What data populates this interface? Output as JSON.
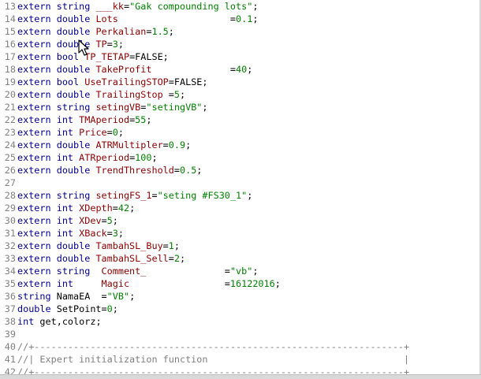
{
  "editor": {
    "lines": [
      {
        "num": "13",
        "tokens": [
          {
            "t": "extern string ",
            "c": "kw"
          },
          {
            "t": "___kk",
            "c": "id"
          },
          {
            "t": "=",
            "c": "op"
          },
          {
            "t": "\"Gak compounding lots\"",
            "c": "str"
          },
          {
            "t": ";",
            "c": "op"
          }
        ]
      },
      {
        "num": "14",
        "tokens": [
          {
            "t": "extern double ",
            "c": "kw"
          },
          {
            "t": "Lots",
            "c": "id"
          },
          {
            "t": "                    =",
            "c": "op"
          },
          {
            "t": "0.1",
            "c": "num"
          },
          {
            "t": ";",
            "c": "op"
          }
        ]
      },
      {
        "num": "15",
        "tokens": [
          {
            "t": "extern double ",
            "c": "kw"
          },
          {
            "t": "Perkalian",
            "c": "id"
          },
          {
            "t": "=",
            "c": "op"
          },
          {
            "t": "1.5",
            "c": "num"
          },
          {
            "t": ";",
            "c": "op"
          }
        ]
      },
      {
        "num": "16",
        "tokens": [
          {
            "t": "extern double ",
            "c": "kw"
          },
          {
            "t": "TP",
            "c": "id"
          },
          {
            "t": "=",
            "c": "op"
          },
          {
            "t": "3",
            "c": "num"
          },
          {
            "t": ";",
            "c": "op"
          }
        ]
      },
      {
        "num": "17",
        "tokens": [
          {
            "t": "extern bool ",
            "c": "kw"
          },
          {
            "t": "TP_TETAP",
            "c": "id"
          },
          {
            "t": "=FALSE;",
            "c": "op"
          }
        ]
      },
      {
        "num": "18",
        "tokens": [
          {
            "t": "extern double ",
            "c": "kw"
          },
          {
            "t": "TakeProfit",
            "c": "id"
          },
          {
            "t": "              =",
            "c": "op"
          },
          {
            "t": "40",
            "c": "num"
          },
          {
            "t": ";",
            "c": "op"
          }
        ]
      },
      {
        "num": "19",
        "tokens": [
          {
            "t": "extern bool ",
            "c": "kw"
          },
          {
            "t": "UseTrailingSTOP",
            "c": "id"
          },
          {
            "t": "=FALSE;",
            "c": "op"
          }
        ]
      },
      {
        "num": "20",
        "tokens": [
          {
            "t": "extern double ",
            "c": "kw"
          },
          {
            "t": "TrailingStop",
            "c": "id"
          },
          {
            "t": " =",
            "c": "op"
          },
          {
            "t": "5",
            "c": "num"
          },
          {
            "t": ";",
            "c": "op"
          }
        ]
      },
      {
        "num": "21",
        "tokens": [
          {
            "t": "extern string ",
            "c": "kw"
          },
          {
            "t": "setingVB",
            "c": "id"
          },
          {
            "t": "=",
            "c": "op"
          },
          {
            "t": "\"setingVB\"",
            "c": "str"
          },
          {
            "t": ";",
            "c": "op"
          }
        ]
      },
      {
        "num": "22",
        "tokens": [
          {
            "t": "extern int ",
            "c": "kw"
          },
          {
            "t": "TMAperiod",
            "c": "id"
          },
          {
            "t": "=",
            "c": "op"
          },
          {
            "t": "55",
            "c": "num"
          },
          {
            "t": ";",
            "c": "op"
          }
        ]
      },
      {
        "num": "23",
        "tokens": [
          {
            "t": "extern int ",
            "c": "kw"
          },
          {
            "t": "Price",
            "c": "id"
          },
          {
            "t": "=",
            "c": "op"
          },
          {
            "t": "0",
            "c": "num"
          },
          {
            "t": ";",
            "c": "op"
          }
        ]
      },
      {
        "num": "24",
        "tokens": [
          {
            "t": "extern double ",
            "c": "kw"
          },
          {
            "t": "ATRMultipler",
            "c": "id"
          },
          {
            "t": "=",
            "c": "op"
          },
          {
            "t": "0.9",
            "c": "num"
          },
          {
            "t": ";",
            "c": "op"
          }
        ]
      },
      {
        "num": "25",
        "tokens": [
          {
            "t": "extern int ",
            "c": "kw"
          },
          {
            "t": "ATRperiod",
            "c": "id"
          },
          {
            "t": "=",
            "c": "op"
          },
          {
            "t": "100",
            "c": "num"
          },
          {
            "t": ";",
            "c": "op"
          }
        ]
      },
      {
        "num": "26",
        "tokens": [
          {
            "t": "extern double ",
            "c": "kw"
          },
          {
            "t": "TrendThreshold",
            "c": "id"
          },
          {
            "t": "=",
            "c": "op"
          },
          {
            "t": "0.5",
            "c": "num"
          },
          {
            "t": ";",
            "c": "op"
          }
        ]
      },
      {
        "num": "27",
        "tokens": []
      },
      {
        "num": "28",
        "tokens": [
          {
            "t": "extern string ",
            "c": "kw"
          },
          {
            "t": "setingFS_1",
            "c": "id"
          },
          {
            "t": "=",
            "c": "op"
          },
          {
            "t": "\"seting #FS30_1\"",
            "c": "str"
          },
          {
            "t": ";",
            "c": "op"
          }
        ]
      },
      {
        "num": "29",
        "tokens": [
          {
            "t": "extern int ",
            "c": "kw"
          },
          {
            "t": "XDepth",
            "c": "id"
          },
          {
            "t": "=",
            "c": "op"
          },
          {
            "t": "42",
            "c": "num"
          },
          {
            "t": ";",
            "c": "op"
          }
        ]
      },
      {
        "num": "30",
        "tokens": [
          {
            "t": "extern int ",
            "c": "kw"
          },
          {
            "t": "XDev",
            "c": "id"
          },
          {
            "t": "=",
            "c": "op"
          },
          {
            "t": "5",
            "c": "num"
          },
          {
            "t": ";",
            "c": "op"
          }
        ]
      },
      {
        "num": "31",
        "tokens": [
          {
            "t": "extern int ",
            "c": "kw"
          },
          {
            "t": "XBack",
            "c": "id"
          },
          {
            "t": "=",
            "c": "op"
          },
          {
            "t": "3",
            "c": "num"
          },
          {
            "t": ";",
            "c": "op"
          }
        ]
      },
      {
        "num": "32",
        "tokens": [
          {
            "t": "extern double ",
            "c": "kw"
          },
          {
            "t": "TambahSL_Buy",
            "c": "id"
          },
          {
            "t": "=",
            "c": "op"
          },
          {
            "t": "1",
            "c": "num"
          },
          {
            "t": ";",
            "c": "op"
          }
        ]
      },
      {
        "num": "33",
        "tokens": [
          {
            "t": "extern double ",
            "c": "kw"
          },
          {
            "t": "TambahSL_Sell",
            "c": "id"
          },
          {
            "t": "=",
            "c": "op"
          },
          {
            "t": "2",
            "c": "num"
          },
          {
            "t": ";",
            "c": "op"
          }
        ]
      },
      {
        "num": "34",
        "tokens": [
          {
            "t": "extern string  ",
            "c": "kw"
          },
          {
            "t": "Comment_",
            "c": "id"
          },
          {
            "t": "              =",
            "c": "op"
          },
          {
            "t": "\"vb\"",
            "c": "str"
          },
          {
            "t": ";",
            "c": "op"
          }
        ]
      },
      {
        "num": "35",
        "tokens": [
          {
            "t": "extern int     ",
            "c": "kw"
          },
          {
            "t": "Magic",
            "c": "id"
          },
          {
            "t": "                 =",
            "c": "op"
          },
          {
            "t": "16122016",
            "c": "num"
          },
          {
            "t": ";",
            "c": "op"
          }
        ]
      },
      {
        "num": "36",
        "tokens": [
          {
            "t": "string ",
            "c": "kw"
          },
          {
            "t": "NamaEA  =",
            "c": "op"
          },
          {
            "t": "\"VB\"",
            "c": "str"
          },
          {
            "t": ";",
            "c": "op"
          }
        ]
      },
      {
        "num": "37",
        "tokens": [
          {
            "t": "double ",
            "c": "kw"
          },
          {
            "t": "SetPoint=",
            "c": "op"
          },
          {
            "t": "0",
            "c": "num"
          },
          {
            "t": ";",
            "c": "op"
          }
        ]
      },
      {
        "num": "38",
        "tokens": [
          {
            "t": "int ",
            "c": "kw"
          },
          {
            "t": "get,colorz;",
            "c": "op"
          }
        ]
      },
      {
        "num": "39",
        "tokens": []
      },
      {
        "num": "40",
        "tokens": [
          {
            "t": "//+------------------------------------------------------------------+",
            "c": "cm"
          }
        ]
      },
      {
        "num": "41",
        "tokens": [
          {
            "t": "//| Expert initialization function                                   |",
            "c": "cm"
          }
        ]
      },
      {
        "num": "42",
        "tokens": [
          {
            "t": "//+------------------------------------------------------------------+",
            "c": "cm"
          }
        ]
      }
    ]
  }
}
